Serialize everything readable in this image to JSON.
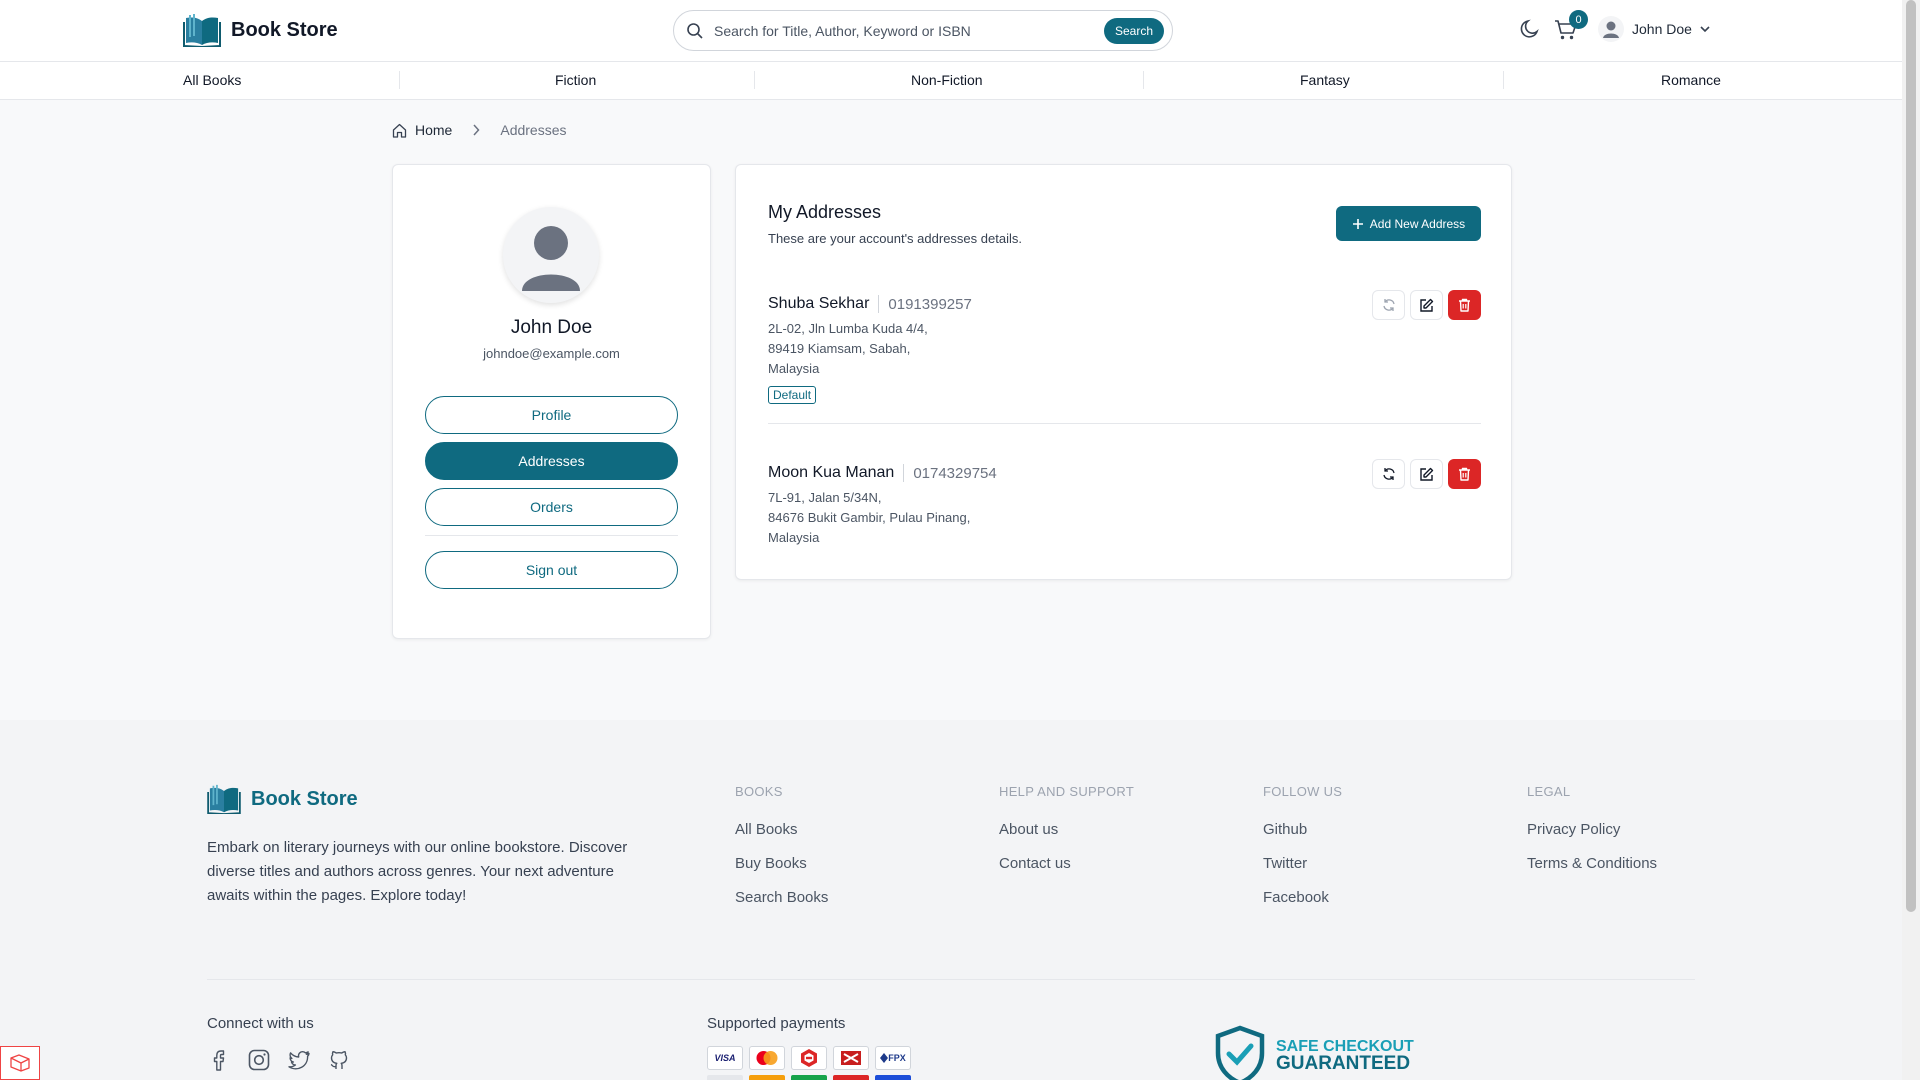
{
  "header": {
    "logo_text": "Book Store",
    "search_placeholder": "Search for Title, Author, Keyword or ISBN",
    "search_button": "Search",
    "cart_count": "0",
    "user_name": "John Doe"
  },
  "categories": [
    "All Books",
    "Fiction",
    "Non-Fiction",
    "Fantasy",
    "Romance"
  ],
  "breadcrumb": {
    "home": "Home",
    "current": "Addresses"
  },
  "profile": {
    "name": "John Doe",
    "email": "johndoe@example.com",
    "buttons": {
      "profile": "Profile",
      "addresses": "Addresses",
      "orders": "Orders",
      "sign_out": "Sign out"
    }
  },
  "addresses": {
    "title": "My Addresses",
    "subtitle": "These are your account's addresses details.",
    "add_button": "Add New Address",
    "items": [
      {
        "name": "Shuba Sekhar",
        "phone": "0191399257",
        "lines": [
          "2L-02, Jln Lumba Kuda 4/4,",
          "89419 Kiamsam, Sabah,",
          "Malaysia"
        ],
        "badge": "Default"
      },
      {
        "name": "Moon Kua Manan",
        "phone": "0174329754",
        "lines": [
          "7L-91, Jalan 5/34N,",
          "84676 Bukit Gambir, Pulau Pinang,",
          "Malaysia"
        ]
      }
    ]
  },
  "footer": {
    "logo_text": "Book Store",
    "description": "Embark on literary journeys with our online bookstore. Discover diverse titles and authors across genres. Your next adventure awaits within the pages. Explore today!",
    "columns": [
      {
        "heading": "BOOKS",
        "links": [
          "All Books",
          "Buy Books",
          "Search Books"
        ]
      },
      {
        "heading": "HELP AND SUPPORT",
        "links": [
          "About us",
          "Contact us"
        ]
      },
      {
        "heading": "FOLLOW US",
        "links": [
          "Github",
          "Twitter",
          "Facebook"
        ]
      },
      {
        "heading": "LEGAL",
        "links": [
          "Privacy Policy",
          "Terms & Conditions"
        ]
      }
    ],
    "connect_label": "Connect with us",
    "payments_label": "Supported payments",
    "payment_visa": "VISA",
    "payment_fpx": "FPX",
    "safe_checkout_line1": "SAFE CHECKOUT",
    "safe_checkout_line2": "GUARANTEED"
  },
  "colors": {
    "accent": "#0f6a80",
    "danger": "#dc2626",
    "page_bg": "#f8f9fa"
  }
}
